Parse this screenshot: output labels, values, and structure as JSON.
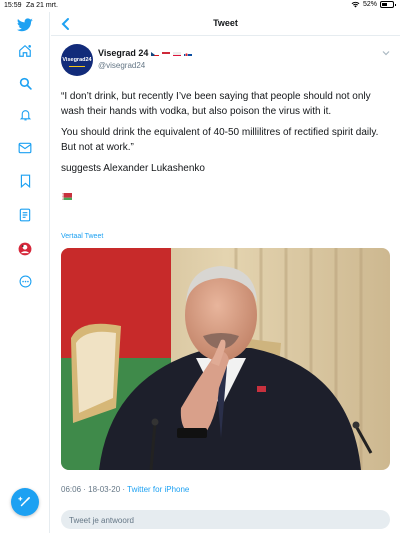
{
  "status_bar": {
    "time": "15:59",
    "date": "Za 21 mrt.",
    "battery": "52%",
    "battery_level": 0.52
  },
  "sidebar": {
    "items": [
      {
        "icon": "twitter-bird-icon"
      },
      {
        "icon": "home-icon"
      },
      {
        "icon": "search-icon"
      },
      {
        "icon": "notifications-bell-icon"
      },
      {
        "icon": "messages-envelope-icon"
      },
      {
        "icon": "bookmark-icon"
      },
      {
        "icon": "lists-icon"
      },
      {
        "icon": "profile-avatar-icon"
      },
      {
        "icon": "more-icon"
      }
    ],
    "compose_icon": "compose-tweet-icon"
  },
  "header": {
    "title": "Tweet",
    "back_icon": "back-chevron-icon"
  },
  "tweet": {
    "avatar_text": "Visegrad24",
    "user_name": "Visegrad 24",
    "user_flags": [
      "Czech",
      "Hungary",
      "Poland",
      "Slovakia"
    ],
    "handle": "@visegrad24",
    "text": [
      "“I don’t drink, but recently I’ve been saying that people should not only wash their hands with vodka, but also poison the virus with it.",
      "You should drink the equivalent of 40-50 millilitres of rectified spirit daily. But not at work.”",
      "suggests Alexander Lukashenko"
    ],
    "flag_emoji": "Belarus",
    "translate_label": "Vertaal Tweet",
    "timestamp": "06:06 · 18-03-20 · ",
    "source": "Twitter for iPhone"
  },
  "reply": {
    "placeholder": "Tweet je antwoord"
  },
  "colors": {
    "twitter_blue": "#1da1f2",
    "text": "#14171a",
    "muted": "#657786",
    "divider": "#e6ecf0"
  }
}
